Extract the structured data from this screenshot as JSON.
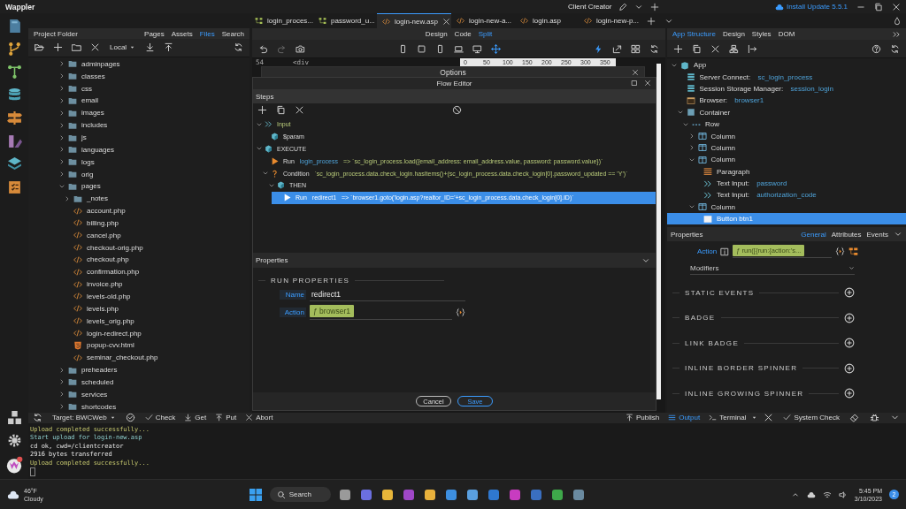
{
  "app": {
    "name": "Wappler",
    "project": "Client Creator",
    "update": "Install Update 5.5.1"
  },
  "editor_tabs": [
    {
      "label": "login_proces...",
      "kind": "flow",
      "selected": false
    },
    {
      "label": "password_u...",
      "kind": "flow",
      "selected": false
    },
    {
      "label": "login-new.asp",
      "kind": "code",
      "selected": true
    },
    {
      "label": "login-new-a...",
      "kind": "code",
      "selected": false
    },
    {
      "label": "login.asp",
      "kind": "code",
      "selected": false
    },
    {
      "label": "login-new-p...",
      "kind": "code",
      "selected": false
    }
  ],
  "left_panel": {
    "title": "Project Folder",
    "tabs": [
      {
        "label": "Pages",
        "selected": false
      },
      {
        "label": "Assets",
        "selected": false
      },
      {
        "label": "Files",
        "selected": true
      },
      {
        "label": "Search",
        "selected": false
      }
    ],
    "target": "Local",
    "files": [
      {
        "label": "adminpages",
        "kind": "folder",
        "expanded": false
      },
      {
        "label": "classes",
        "kind": "folder",
        "expanded": false
      },
      {
        "label": "css",
        "kind": "folder",
        "expanded": false
      },
      {
        "label": "email",
        "kind": "folder",
        "expanded": false
      },
      {
        "label": "images",
        "kind": "folder",
        "expanded": false
      },
      {
        "label": "includes",
        "kind": "folder",
        "expanded": false
      },
      {
        "label": "js",
        "kind": "folder",
        "expanded": false
      },
      {
        "label": "languages",
        "kind": "folder",
        "expanded": false
      },
      {
        "label": "logs",
        "kind": "folder",
        "expanded": false
      },
      {
        "label": "orig",
        "kind": "folder",
        "expanded": false
      },
      {
        "label": "pages",
        "kind": "folder",
        "expanded": true,
        "children": [
          {
            "label": "_notes",
            "kind": "folder",
            "expanded": false
          },
          {
            "label": "account.php",
            "kind": "code"
          },
          {
            "label": "billing.php",
            "kind": "code"
          },
          {
            "label": "cancel.php",
            "kind": "code"
          },
          {
            "label": "checkout-orig.php",
            "kind": "code"
          },
          {
            "label": "checkout.php",
            "kind": "code"
          },
          {
            "label": "confirmation.php",
            "kind": "code"
          },
          {
            "label": "invoice.php",
            "kind": "code"
          },
          {
            "label": "levels-old.php",
            "kind": "code"
          },
          {
            "label": "levels.php",
            "kind": "code"
          },
          {
            "label": "levels_orig.php",
            "kind": "code"
          },
          {
            "label": "login-redirect.php",
            "kind": "code"
          },
          {
            "label": "popup-cvv.html",
            "kind": "html"
          },
          {
            "label": "seminar_checkout.php",
            "kind": "code"
          }
        ]
      },
      {
        "label": "preheaders",
        "kind": "folder",
        "expanded": false
      },
      {
        "label": "scheduled",
        "kind": "folder",
        "expanded": false
      },
      {
        "label": "services",
        "kind": "folder",
        "expanded": false
      },
      {
        "label": "shortcodes",
        "kind": "folder",
        "expanded": false
      }
    ]
  },
  "center": {
    "view_tabs": [
      {
        "label": "Design",
        "selected": false
      },
      {
        "label": "Code",
        "selected": false
      },
      {
        "label": "Split",
        "selected": true
      }
    ],
    "code_line": {
      "number": "54",
      "text": "<div"
    },
    "ruler": [
      "0",
      "50",
      "100",
      "150",
      "200",
      "250",
      "300",
      "350"
    ]
  },
  "options_dialog": {
    "title": "Options"
  },
  "flow_editor": {
    "title": "Flow Editor",
    "steps_title": "Steps",
    "steps": [
      {
        "kind": "input",
        "label": "Input",
        "expanded": true,
        "selected": false,
        "children": [
          {
            "kind": "param",
            "label": "$param",
            "selected": false
          }
        ]
      },
      {
        "kind": "execute",
        "label": "EXECUTE",
        "expanded": true,
        "selected": false,
        "children": [
          {
            "kind": "run",
            "label": "Run",
            "target": "login_process",
            "expr": "=> `sc_login_process.load({email_address: email_address.value, password: password.value})`",
            "selected": false
          },
          {
            "kind": "condition",
            "label": "Condition",
            "expr": "`sc_login_process.data.check_login.hasItems()+(sc_login_process.data.check_login[0].password_updated == 'Y')`",
            "expanded": true,
            "selected": false,
            "children": [
              {
                "kind": "then",
                "label": "THEN",
                "expanded": true,
                "selected": false,
                "children": [
                  {
                    "kind": "run",
                    "label": "Run",
                    "target": "redirect1",
                    "expr": "=> `browser1.goto('login.asp?realtor_ID='+sc_login_process.data.check_login[0].ID)`",
                    "selected": true
                  }
                ]
              }
            ]
          }
        ]
      }
    ],
    "properties_title": "Properties",
    "section": "RUN PROPERTIES",
    "fields": [
      {
        "label": "Name",
        "value": "redirect1",
        "kind": "text"
      },
      {
        "label": "Action",
        "value": "ƒ browser1",
        "kind": "action"
      }
    ],
    "buttons": [
      {
        "label": "Cancel",
        "primary": false
      },
      {
        "label": "Save",
        "primary": true
      }
    ]
  },
  "right_panel": {
    "tabs": [
      {
        "label": "App Structure",
        "selected": true
      },
      {
        "label": "Design",
        "selected": false
      },
      {
        "label": "Styles",
        "selected": false
      },
      {
        "label": "DOM",
        "selected": false
      }
    ],
    "structure": [
      {
        "kind": "app",
        "label": "App",
        "expanded": true,
        "selected": false,
        "children": [
          {
            "kind": "server",
            "label": "Server Connect:",
            "name": "sc_login_process",
            "selected": false
          },
          {
            "kind": "server",
            "label": "Session Storage Manager:",
            "name": "session_login",
            "selected": false
          },
          {
            "kind": "browser",
            "label": "Browser:",
            "name": "browser1",
            "selected": false
          },
          {
            "kind": "container",
            "label": "Container",
            "expanded": true,
            "selected": false,
            "children": [
              {
                "kind": "row",
                "label": "Row",
                "expanded": true,
                "selected": false,
                "children": [
                  {
                    "kind": "column",
                    "label": "Column",
                    "expanded": false,
                    "selected": false
                  },
                  {
                    "kind": "column",
                    "label": "Column",
                    "expanded": false,
                    "selected": false
                  },
                  {
                    "kind": "column",
                    "label": "Column",
                    "expanded": true,
                    "selected": false,
                    "children": [
                      {
                        "kind": "paragraph",
                        "label": "Paragraph",
                        "selected": false
                      },
                      {
                        "kind": "input",
                        "label": "Text Input:",
                        "name": "password",
                        "selected": false
                      },
                      {
                        "kind": "input",
                        "label": "Text Input:",
                        "name": "authorization_code",
                        "selected": false
                      }
                    ]
                  },
                  {
                    "kind": "column",
                    "label": "Column",
                    "expanded": true,
                    "selected": false,
                    "children": [
                      {
                        "kind": "button",
                        "label": "Button btn1",
                        "selected": true
                      }
                    ]
                  }
                ]
              }
            ]
          }
        ]
      }
    ],
    "properties_title": "Properties",
    "property_tabs": [
      {
        "label": "General",
        "selected": true
      },
      {
        "label": "Attributes",
        "selected": false
      },
      {
        "label": "Events",
        "selected": false
      }
    ],
    "action": {
      "label": "Action",
      "value": "ƒ run([{run:{action:'s..."
    },
    "modifiers": {
      "label": "Modifiers"
    },
    "sections": [
      "STATIC EVENTS",
      "BADGE",
      "LINK BADGE",
      "INLINE BORDER SPINNER",
      "INLINE GROWING SPINNER"
    ]
  },
  "bottom_bar": {
    "target": "Target: BWCWeb",
    "left_buttons": [
      {
        "label": "Check",
        "kind": "check"
      },
      {
        "label": "Get",
        "kind": "get"
      },
      {
        "label": "Put",
        "kind": "put"
      },
      {
        "label": "Abort",
        "kind": "abort"
      }
    ],
    "right_buttons": [
      {
        "label": "Publish",
        "kind": "publish",
        "selected": false
      },
      {
        "label": "Output",
        "kind": "output",
        "selected": true
      },
      {
        "label": "Terminal",
        "kind": "terminal",
        "selected": false
      }
    ],
    "system_check": "System Check"
  },
  "output": [
    {
      "text": "Upload completed successfully...",
      "kind": "success"
    },
    {
      "text": "Start upload for login-new.asp",
      "kind": "info"
    },
    {
      "text": "cd ok, cwd=/clientcreator",
      "kind": "plain"
    },
    {
      "text": "2916 bytes transferred",
      "kind": "plain"
    },
    {
      "text": "Upload completed successfully...",
      "kind": "success"
    }
  ],
  "taskbar": {
    "temperature": "46°F",
    "condition": "Cloudy",
    "search": "Search",
    "time": "5:45 PM",
    "date": "3/10/2023",
    "notifications": "2"
  }
}
